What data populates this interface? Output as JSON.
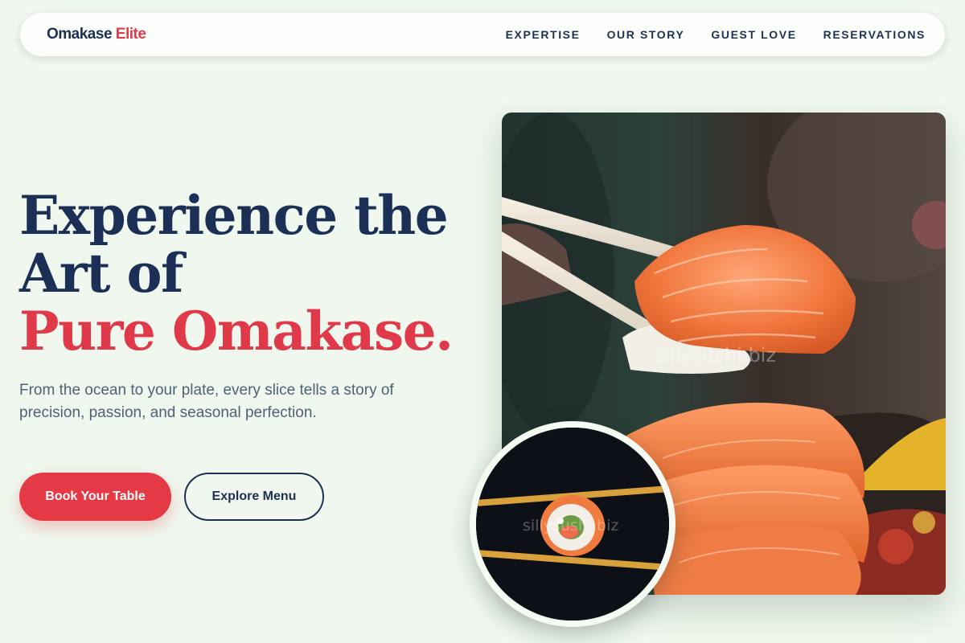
{
  "brand": {
    "name_primary": "Omakase",
    "name_accent": "Elite"
  },
  "nav": {
    "items": [
      {
        "label": "EXPERTISE"
      },
      {
        "label": "OUR STORY"
      },
      {
        "label": "GUEST LOVE"
      },
      {
        "label": "RESERVATIONS"
      }
    ]
  },
  "hero": {
    "headline_line1": "Experience the",
    "headline_line2": "Art of",
    "headline_accent": "Pure Omakase.",
    "subtext": "From the ocean to your plate, every slice tells a story of precision, passion, and seasonal perfection.",
    "primary_button": "Book Your Table",
    "secondary_button": "Explore Menu"
  },
  "images": {
    "main_watermark": "sillysushi.biz",
    "thumb_watermark": "sillysushi.biz"
  },
  "colors": {
    "background": "#eff7ee",
    "navy": "#1c3057",
    "accent_red": "#e63946",
    "subtext": "#4e6277"
  }
}
